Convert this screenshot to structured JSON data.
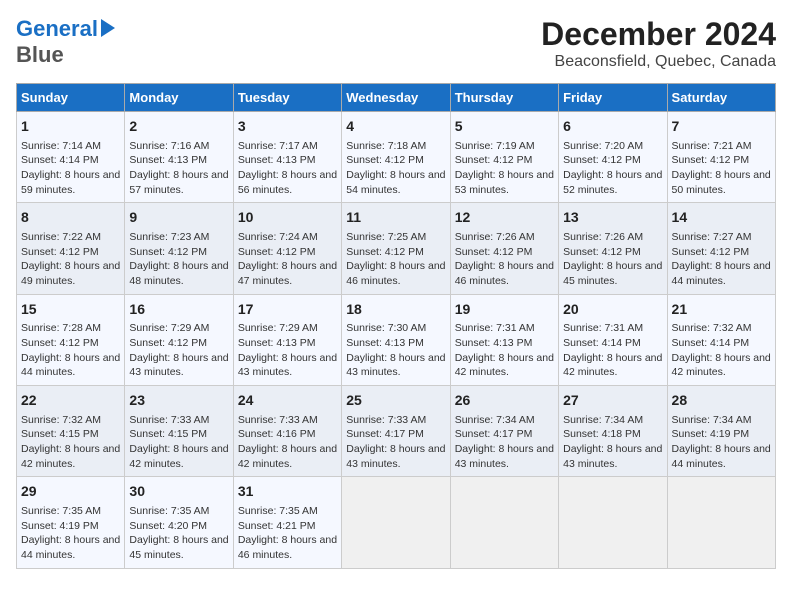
{
  "header": {
    "logo_line1": "General",
    "logo_line2": "Blue",
    "title": "December 2024",
    "subtitle": "Beaconsfield, Quebec, Canada"
  },
  "days_of_week": [
    "Sunday",
    "Monday",
    "Tuesday",
    "Wednesday",
    "Thursday",
    "Friday",
    "Saturday"
  ],
  "weeks": [
    [
      {
        "day": 1,
        "sunrise": "7:14 AM",
        "sunset": "4:14 PM",
        "daylight": "8 hours and 59 minutes."
      },
      {
        "day": 2,
        "sunrise": "7:16 AM",
        "sunset": "4:13 PM",
        "daylight": "8 hours and 57 minutes."
      },
      {
        "day": 3,
        "sunrise": "7:17 AM",
        "sunset": "4:13 PM",
        "daylight": "8 hours and 56 minutes."
      },
      {
        "day": 4,
        "sunrise": "7:18 AM",
        "sunset": "4:12 PM",
        "daylight": "8 hours and 54 minutes."
      },
      {
        "day": 5,
        "sunrise": "7:19 AM",
        "sunset": "4:12 PM",
        "daylight": "8 hours and 53 minutes."
      },
      {
        "day": 6,
        "sunrise": "7:20 AM",
        "sunset": "4:12 PM",
        "daylight": "8 hours and 52 minutes."
      },
      {
        "day": 7,
        "sunrise": "7:21 AM",
        "sunset": "4:12 PM",
        "daylight": "8 hours and 50 minutes."
      }
    ],
    [
      {
        "day": 8,
        "sunrise": "7:22 AM",
        "sunset": "4:12 PM",
        "daylight": "8 hours and 49 minutes."
      },
      {
        "day": 9,
        "sunrise": "7:23 AM",
        "sunset": "4:12 PM",
        "daylight": "8 hours and 48 minutes."
      },
      {
        "day": 10,
        "sunrise": "7:24 AM",
        "sunset": "4:12 PM",
        "daylight": "8 hours and 47 minutes."
      },
      {
        "day": 11,
        "sunrise": "7:25 AM",
        "sunset": "4:12 PM",
        "daylight": "8 hours and 46 minutes."
      },
      {
        "day": 12,
        "sunrise": "7:26 AM",
        "sunset": "4:12 PM",
        "daylight": "8 hours and 46 minutes."
      },
      {
        "day": 13,
        "sunrise": "7:26 AM",
        "sunset": "4:12 PM",
        "daylight": "8 hours and 45 minutes."
      },
      {
        "day": 14,
        "sunrise": "7:27 AM",
        "sunset": "4:12 PM",
        "daylight": "8 hours and 44 minutes."
      }
    ],
    [
      {
        "day": 15,
        "sunrise": "7:28 AM",
        "sunset": "4:12 PM",
        "daylight": "8 hours and 44 minutes."
      },
      {
        "day": 16,
        "sunrise": "7:29 AM",
        "sunset": "4:12 PM",
        "daylight": "8 hours and 43 minutes."
      },
      {
        "day": 17,
        "sunrise": "7:29 AM",
        "sunset": "4:13 PM",
        "daylight": "8 hours and 43 minutes."
      },
      {
        "day": 18,
        "sunrise": "7:30 AM",
        "sunset": "4:13 PM",
        "daylight": "8 hours and 43 minutes."
      },
      {
        "day": 19,
        "sunrise": "7:31 AM",
        "sunset": "4:13 PM",
        "daylight": "8 hours and 42 minutes."
      },
      {
        "day": 20,
        "sunrise": "7:31 AM",
        "sunset": "4:14 PM",
        "daylight": "8 hours and 42 minutes."
      },
      {
        "day": 21,
        "sunrise": "7:32 AM",
        "sunset": "4:14 PM",
        "daylight": "8 hours and 42 minutes."
      }
    ],
    [
      {
        "day": 22,
        "sunrise": "7:32 AM",
        "sunset": "4:15 PM",
        "daylight": "8 hours and 42 minutes."
      },
      {
        "day": 23,
        "sunrise": "7:33 AM",
        "sunset": "4:15 PM",
        "daylight": "8 hours and 42 minutes."
      },
      {
        "day": 24,
        "sunrise": "7:33 AM",
        "sunset": "4:16 PM",
        "daylight": "8 hours and 42 minutes."
      },
      {
        "day": 25,
        "sunrise": "7:33 AM",
        "sunset": "4:17 PM",
        "daylight": "8 hours and 43 minutes."
      },
      {
        "day": 26,
        "sunrise": "7:34 AM",
        "sunset": "4:17 PM",
        "daylight": "8 hours and 43 minutes."
      },
      {
        "day": 27,
        "sunrise": "7:34 AM",
        "sunset": "4:18 PM",
        "daylight": "8 hours and 43 minutes."
      },
      {
        "day": 28,
        "sunrise": "7:34 AM",
        "sunset": "4:19 PM",
        "daylight": "8 hours and 44 minutes."
      }
    ],
    [
      {
        "day": 29,
        "sunrise": "7:35 AM",
        "sunset": "4:19 PM",
        "daylight": "8 hours and 44 minutes."
      },
      {
        "day": 30,
        "sunrise": "7:35 AM",
        "sunset": "4:20 PM",
        "daylight": "8 hours and 45 minutes."
      },
      {
        "day": 31,
        "sunrise": "7:35 AM",
        "sunset": "4:21 PM",
        "daylight": "8 hours and 46 minutes."
      },
      null,
      null,
      null,
      null
    ]
  ]
}
